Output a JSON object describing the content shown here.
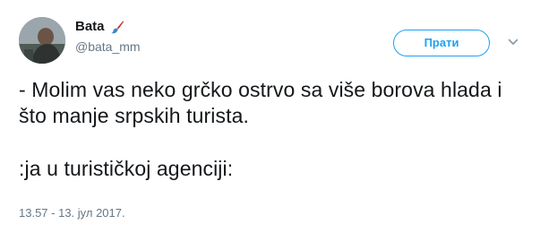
{
  "user": {
    "display_name": "Bata",
    "handle": "@bata_mm",
    "avatar_icon": "profile-photo",
    "name_emoji_icon": "paintbrush-icon"
  },
  "actions": {
    "follow_label": "Прати",
    "menu_icon": "chevron-down-icon"
  },
  "tweet": {
    "text_paragraph_1": "- Molim vas neko grčko ostrvo sa više borova hlada i što manje srpskih turista.",
    "text_paragraph_2": ":ja u turističkoj agenciji:",
    "timestamp": "13.57 - 13. јул 2017."
  },
  "colors": {
    "accent": "#1da1f2",
    "text": "#14171a",
    "muted": "#657786"
  }
}
